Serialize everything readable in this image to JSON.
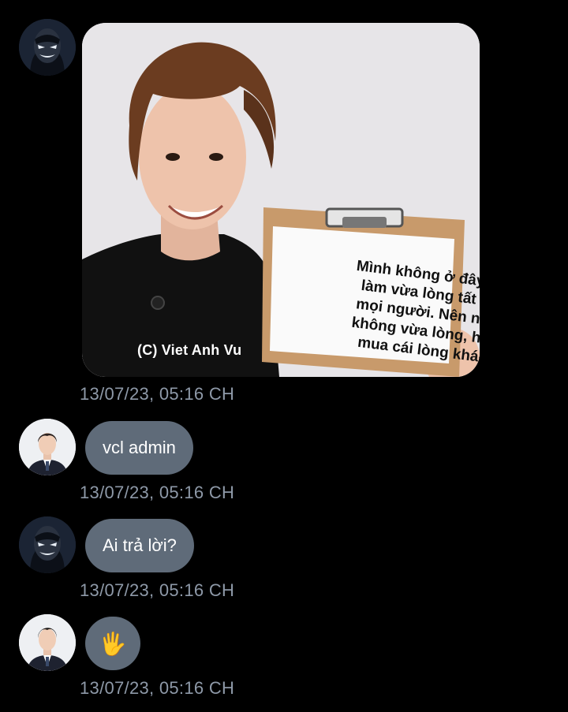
{
  "messages": [
    {
      "type": "image",
      "image": {
        "note_text": "Mình không ở đây để làm vừa lòng tất cả mọi người. Nên nếu không vừa lòng, hãy mua cái lòng khác",
        "credit": "(C) Viet Anh Vu"
      },
      "timestamp": "13/07/23, 05:16 CH"
    },
    {
      "type": "text",
      "text": "vcl admin",
      "timestamp": "13/07/23, 05:16 CH"
    },
    {
      "type": "text",
      "text": "Ai trả lời?",
      "timestamp": "13/07/23, 05:16 CH"
    },
    {
      "type": "emoji",
      "text": "🖐",
      "timestamp": "13/07/23, 05:16 CH"
    }
  ],
  "colors": {
    "background": "#000000",
    "bubble": "#5f6b79",
    "timestamp": "#8e99a8"
  }
}
